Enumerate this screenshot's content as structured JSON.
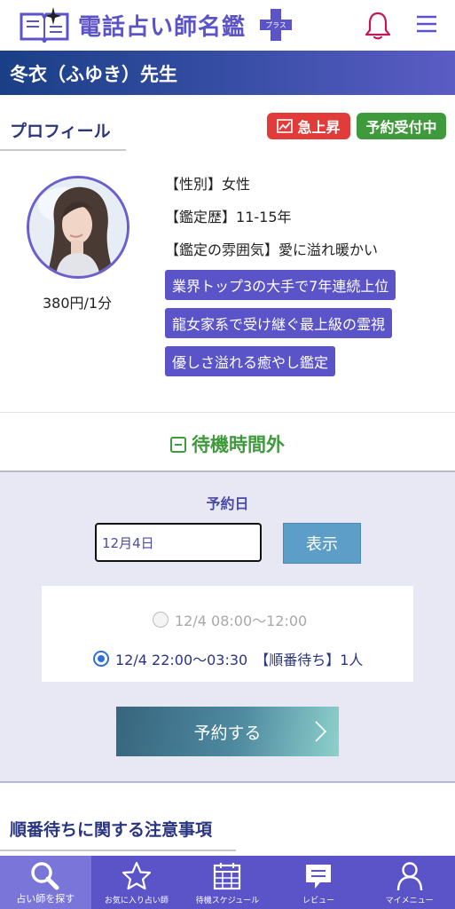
{
  "header": {
    "logo_text": "電話占い師名鑑",
    "logo_plus_text": "プラス"
  },
  "title_bar": {
    "title": "冬衣（ふゆき）先生"
  },
  "profile": {
    "heading": "プロフィール",
    "badges": [
      {
        "label": "急上昇",
        "color": "#e13b3a"
      },
      {
        "label": "予約受付中",
        "color": "#3f9a3b"
      }
    ],
    "price": "380円/1分",
    "info": [
      {
        "key": "【性別】",
        "value": "女性"
      },
      {
        "key": "【鑑定歴】",
        "value": "11-15年"
      },
      {
        "key": "【鑑定の雰囲気】",
        "value": "愛に溢れ暖かい"
      }
    ],
    "tags": [
      "業界トップ3の大手で7年連続上位",
      "龍女家系で受け継ぐ最上級の霊視",
      "優しさ溢れる癒やし鑑定"
    ]
  },
  "status": {
    "label": "待機時間外"
  },
  "reservation": {
    "date_label": "予約日",
    "date_value": "12月4日",
    "show_button": "表示",
    "slots": [
      {
        "label": "12/4 08:00〜12:00",
        "selected": false,
        "enabled": false
      },
      {
        "label": "12/4 22:00〜03:30",
        "queue_label": "【順番待ち】1人",
        "selected": true,
        "enabled": true
      }
    ],
    "reserve_button": "予約する"
  },
  "notice": {
    "heading": "順番待ちに関する注意事項"
  },
  "bottom_nav": [
    {
      "label": "占い師を探す",
      "icon": "search-icon",
      "active": true
    },
    {
      "label": "お気に入り占い師",
      "icon": "star-icon",
      "active": false
    },
    {
      "label": "待機スケジュール",
      "icon": "calendar-icon",
      "active": false
    },
    {
      "label": "レビュー",
      "icon": "chat-icon",
      "active": false
    },
    {
      "label": "マイメニュー",
      "icon": "user-icon",
      "active": false
    }
  ],
  "colors": {
    "brand": "#5b54c8",
    "title_bar": "#1a3f86",
    "badge_hot": "#e13b3a",
    "badge_open": "#3f9a3b",
    "status_green": "#3f9a3b",
    "bell": "#c2185b"
  }
}
